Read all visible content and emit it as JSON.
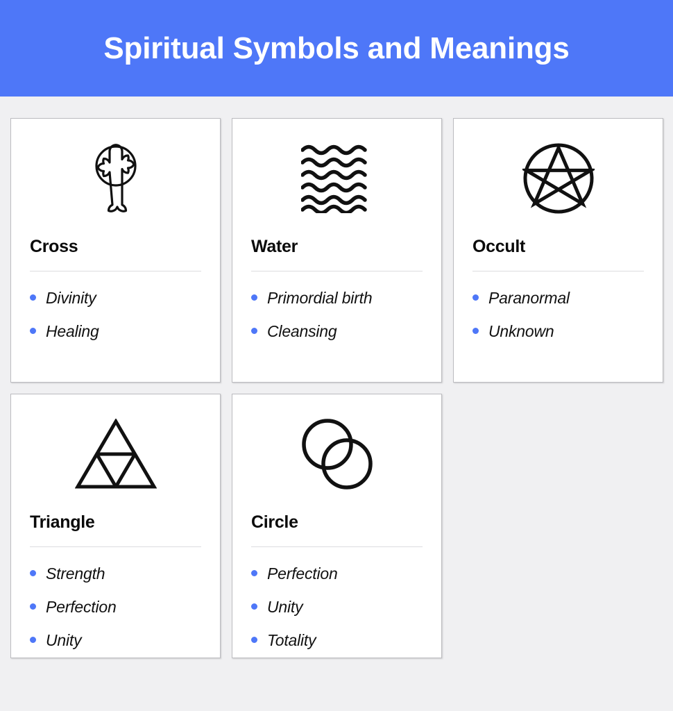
{
  "header": {
    "title": "Spiritual Symbols and Meanings",
    "background_color": "#4e77f8",
    "text_color": "#ffffff"
  },
  "theme": {
    "page_background": "#f0f0f2",
    "card_background": "#ffffff",
    "card_border_color": "#bcbcc0",
    "accent_color": "#4e77f8",
    "divider_color": "#dcdcdf",
    "title_color": "#0b0b0b",
    "text_color": "#111111"
  },
  "cards": [
    {
      "icon": "celtic-cross-icon",
      "title": "Cross",
      "meanings": [
        "Divinity",
        "Healing"
      ]
    },
    {
      "icon": "water-waves-icon",
      "title": "Water",
      "meanings": [
        "Primordial birth",
        "Cleansing"
      ]
    },
    {
      "icon": "pentacle-icon",
      "title": "Occult",
      "meanings": [
        "Paranormal",
        "Unknown"
      ]
    },
    {
      "icon": "triforce-triangle-icon",
      "title": "Triangle",
      "meanings": [
        "Strength",
        "Perfection",
        "Unity"
      ]
    },
    {
      "icon": "overlapping-circles-icon",
      "title": "Circle",
      "meanings": [
        "Perfection",
        "Unity",
        "Totality"
      ]
    }
  ]
}
